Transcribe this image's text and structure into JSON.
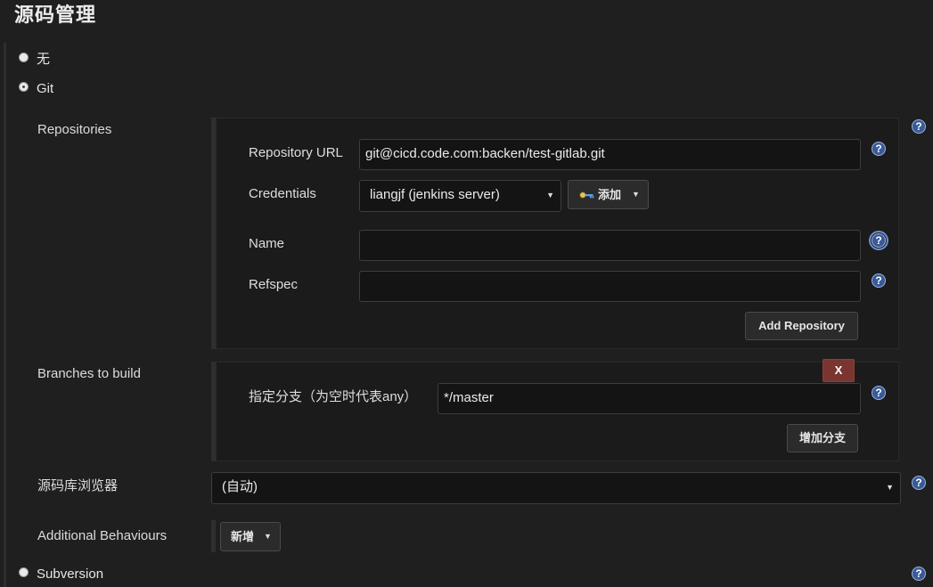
{
  "section": {
    "title": "源码管理"
  },
  "scm_options": {
    "none_label": "无",
    "git_label": "Git",
    "subversion_label": "Subversion",
    "selected": "Git"
  },
  "repositories": {
    "label": "Repositories",
    "url_label": "Repository URL",
    "url_value": "git@cicd.code.com:backen/test-gitlab.git",
    "credentials_label": "Credentials",
    "credentials_value": "liangjf (jenkins server)",
    "add_label": "添加",
    "name_label": "Name",
    "name_value": "",
    "refspec_label": "Refspec",
    "refspec_value": "",
    "add_repository_label": "Add Repository"
  },
  "branches": {
    "label": "Branches to build",
    "delete_label": "X",
    "spec_label": "指定分支（为空时代表any）",
    "spec_value": "*/master",
    "add_branch_label": "增加分支"
  },
  "browser": {
    "label": "源码库浏览器",
    "value": "(自动)"
  },
  "behaviours": {
    "label": "Additional Behaviours",
    "add_label": "新增"
  },
  "icons": {
    "help": "help-question-icon",
    "credentials_key": "key-icon",
    "caret": "caret-down-icon"
  },
  "help_glyph": "?",
  "caret_glyph": "▼",
  "colors": {
    "background": "#1f1f1f",
    "panel": "#1b1b1b",
    "help_blue": "#3a5a97",
    "delete_red": "#7a3530"
  }
}
